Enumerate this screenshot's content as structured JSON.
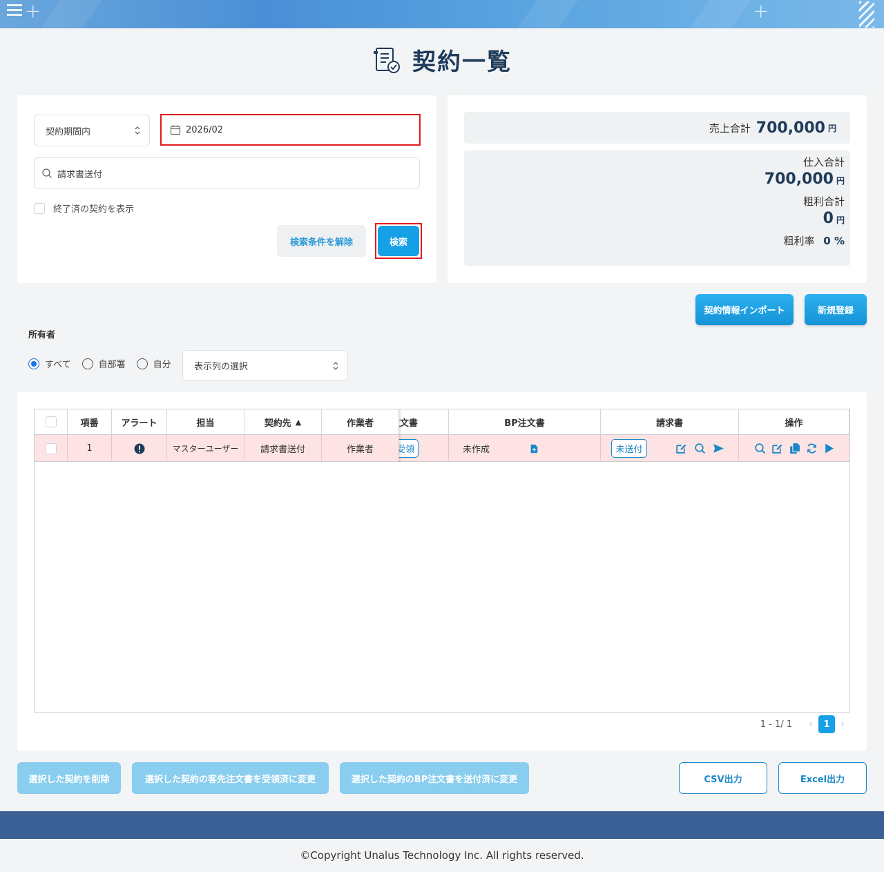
{
  "page": {
    "title": "契約一覧"
  },
  "search": {
    "period_select": "契約期間内",
    "date_value": "2026/02",
    "keyword_value": "請求書送付",
    "show_finished_label": "終了済の契約を表示",
    "clear_label": "検索条件を解除",
    "search_label": "検索"
  },
  "summary": {
    "sales_label": "売上合計",
    "sales_value": "700,000",
    "purchase_label": "仕入合計",
    "purchase_value": "700,000",
    "profit_label": "粗利合計",
    "profit_value": "0",
    "rate_label": "粗利率",
    "rate_value": "0 %",
    "yen": "円"
  },
  "actions": {
    "import_label": "契約情報インポート",
    "new_label": "新規登録"
  },
  "owner": {
    "label": "所有者",
    "options": [
      "すべて",
      "自部署",
      "自分"
    ],
    "selected": "すべて",
    "column_select": "表示列の選択"
  },
  "table": {
    "headers": [
      "項番",
      "アラート",
      "担当",
      "契約先",
      "作業者",
      "注文書",
      "BP注文書",
      "請求書",
      "操作"
    ],
    "sort_indicator": "▲",
    "rows": [
      {
        "no": "1",
        "tantou": "マスターユーザー",
        "keiyakusaki": "請求書送付",
        "sagyousha": "作業者",
        "order_status": "受領",
        "bp_status": "未作成",
        "invoice_status": "未送付"
      }
    ]
  },
  "pager": {
    "range": "1 - 1/ 1",
    "current": "1",
    "prev": "‹",
    "next": "›"
  },
  "bottom": {
    "delete_label": "選択した契約を削除",
    "client_order_label": "選択した契約の客先注文書を受領済に変更",
    "bp_order_label": "選択した契約のBP注文書を送付済に変更",
    "csv_label": "CSV出力",
    "excel_label": "Excel出力"
  },
  "footer": {
    "copyright": "©Copyright Unalus Technology Inc. All rights reserved."
  },
  "colors": {
    "primary": "#16a0e6",
    "title": "#1f3b5a",
    "footer": "#3b6096",
    "highlight_row": "#fde3e3",
    "alert_border": "#e11b1b"
  }
}
